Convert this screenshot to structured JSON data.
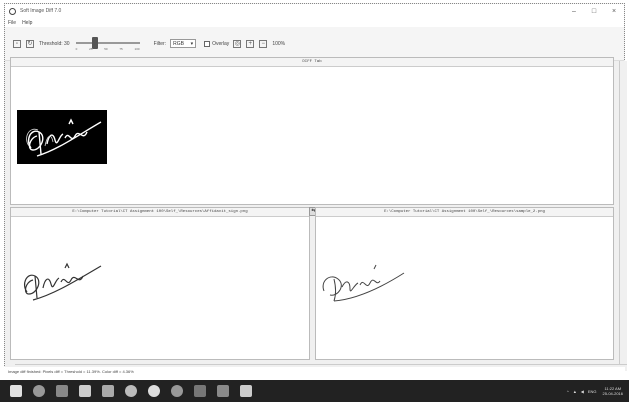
{
  "window": {
    "title": "Soft Image Diff 7.0",
    "controls": {
      "minimize": "–",
      "maximize": "□",
      "close": "×"
    }
  },
  "menu": {
    "items": [
      "File",
      "Help"
    ]
  },
  "toolbar": {
    "threshold_label": "Threshold: 30",
    "threshold_ticks": [
      "0",
      "25",
      "50",
      "75",
      "100"
    ],
    "threshold_value": 30,
    "filter_label": "Filter:",
    "filter_value": "RGB",
    "overlay_label": "Overlay",
    "zoom_label": "100%",
    "icons": [
      "save-icon",
      "refresh-icon",
      "fit-icon",
      "zoom-in-icon",
      "zoom-out-icon"
    ]
  },
  "panels": {
    "diff_title": "DIFF Tab",
    "left_path": "E:\\Computer Tutorial\\CT Assignment 100\\Self_\\Resources\\Affidavit_sign.png",
    "right_path": "E:\\Computer Tutorial\\CT Assignment 100\\Self_\\Resources\\sample_2.png",
    "swap": "⇆"
  },
  "status": {
    "text": "Image diff finished: Pixels diff = Threshold = 11.39%. Color diff = 4.36%"
  },
  "taskbar": {
    "tray_text": "ENG",
    "time": "11:22 AM",
    "date": "25-04-2016"
  }
}
